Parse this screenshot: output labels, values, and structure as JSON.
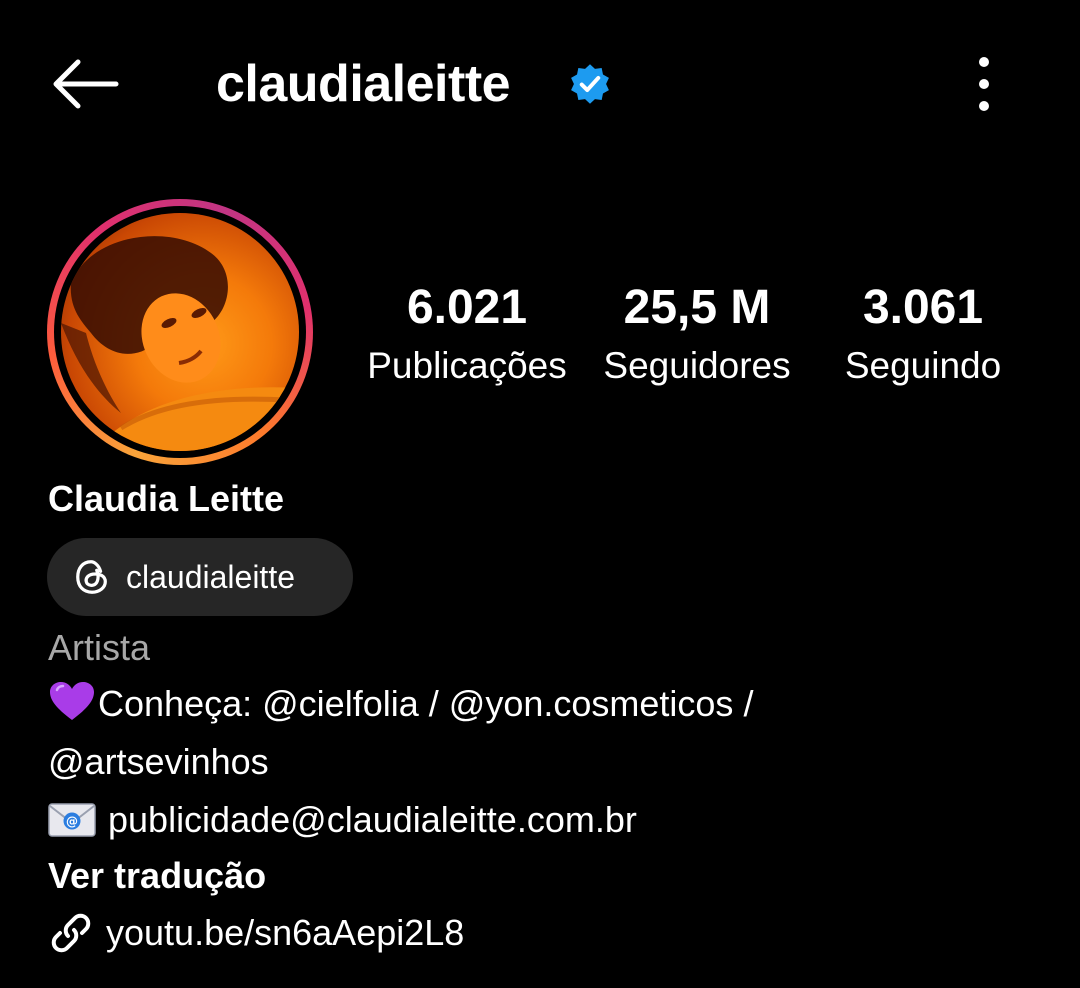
{
  "header": {
    "back_icon": "arrow-left-icon",
    "username": "claudialeitte",
    "verified_icon": "verified-badge-icon",
    "more_icon": "more-vertical-icon",
    "colors": {
      "verified": "#1d9bf0",
      "background": "#000000"
    }
  },
  "profile": {
    "avatar": "profile-photo",
    "stats": [
      {
        "value": "6.021",
        "label": "Publicações"
      },
      {
        "value": "25,5 M",
        "label": "Seguidores"
      },
      {
        "value": "3.061",
        "label": "Seguindo"
      }
    ],
    "display_name": "Claudia Leitte",
    "threads_badge": {
      "icon": "threads-icon",
      "handle": "claudialeitte"
    },
    "category": "Artista",
    "bio": {
      "line1": {
        "emoji_icon": "purple-heart-icon",
        "prefix": "Conheça:",
        "mention1": "@cielfolia",
        "separator1": "/",
        "mention2": "@yon.cosmeticos",
        "separator2": "/"
      },
      "line2": {
        "mention3": "@artsevinhos"
      },
      "line3": {
        "emoji_icon": "email-icon",
        "email": "publicidade@claudialeitte.com.br"
      }
    },
    "translate_label": "Ver tradução",
    "link": {
      "icon": "link-icon",
      "text": "youtu.be/sn6aAepi2L8"
    }
  }
}
